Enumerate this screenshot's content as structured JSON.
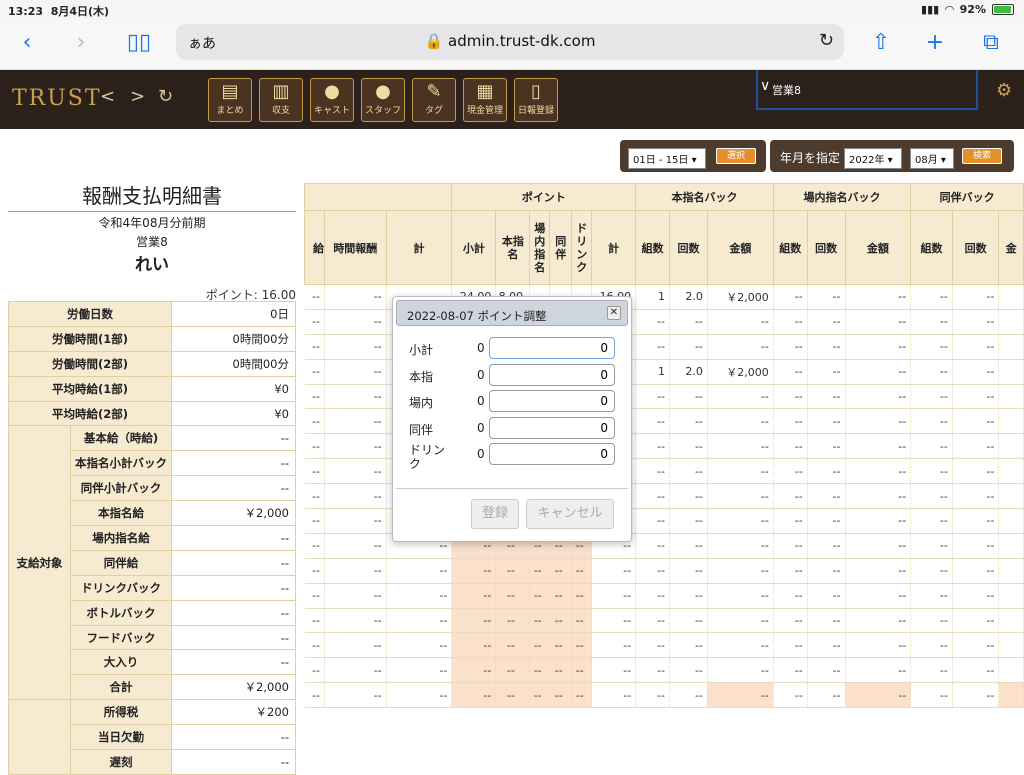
{
  "status": {
    "time": "13:23",
    "date": "8月4日(木)",
    "battery": "92%"
  },
  "browser": {
    "aa": "ぁあ",
    "url": "admin.trust-dk.com"
  },
  "app": {
    "logo": "TRUST",
    "tools": [
      "まとめ",
      "収支",
      "キャスト",
      "スタッフ",
      "タグ",
      "現金管理",
      "日報登録"
    ],
    "staff": "営業8"
  },
  "filters": {
    "range": "01日 - 15日",
    "select_btn": "選択",
    "month_label": "年月を指定",
    "year": "2022年",
    "month": "08月",
    "search_btn": "検索"
  },
  "left": {
    "title": "報酬支払明細書",
    "period": "令和4年08月分前期",
    "dept": "営業8",
    "name": "れい",
    "points": "ポイント: 16.00",
    "rows": [
      {
        "label": "労働日数",
        "value": "0日"
      },
      {
        "label": "労働時間(1部)",
        "value": "0時間00分"
      },
      {
        "label": "労働時間(2部)",
        "value": "0時間00分"
      },
      {
        "label": "平均時給(1部)",
        "value": "¥0"
      },
      {
        "label": "平均時給(2部)",
        "value": "¥0"
      }
    ],
    "pay_group": "支給対象",
    "pay_rows": [
      {
        "label": "基本給（時給)",
        "value": "--"
      },
      {
        "label": "本指名小計バック",
        "value": "--"
      },
      {
        "label": "同伴小計バック",
        "value": "--"
      },
      {
        "label": "本指名給",
        "value": "￥2,000"
      },
      {
        "label": "場内指名給",
        "value": "--"
      },
      {
        "label": "同伴給",
        "value": "--"
      },
      {
        "label": "ドリンクバック",
        "value": "--"
      },
      {
        "label": "ボトルバック",
        "value": "--"
      },
      {
        "label": "フードバック",
        "value": "--"
      },
      {
        "label": "大入り",
        "value": "--"
      },
      {
        "label": "合計",
        "value": "￥2,000"
      }
    ],
    "ded_rows": [
      {
        "label": "所得税",
        "value": "￥200"
      },
      {
        "label": "当日欠勤",
        "value": "--"
      },
      {
        "label": "遅刻",
        "value": "--"
      }
    ]
  },
  "table": {
    "groups": [
      "ポイント",
      "本指名バック",
      "場内指名バック",
      "同伴バック"
    ],
    "cols": [
      "給",
      "時間報酬",
      "計",
      "小計",
      "本指名",
      "場内指名",
      "同伴",
      "ドリンク",
      "計",
      "組数",
      "回数",
      "金額",
      "組数",
      "回数",
      "金額",
      "組数",
      "回数",
      "金"
    ],
    "rows": [
      [
        "--",
        "--",
        "",
        "24.00",
        "8.00",
        "",
        "",
        "",
        "16.00",
        "1",
        "2.0",
        "￥2,000",
        "--",
        "--",
        "--",
        "--",
        "--",
        ""
      ],
      [
        "--",
        "--",
        "",
        "",
        "",
        "",
        "",
        "",
        "",
        "--",
        "--",
        "--",
        "--",
        "--",
        "--",
        "--",
        "--",
        ""
      ],
      [
        "--",
        "--",
        "",
        "",
        "",
        "",
        "",
        "",
        "",
        "--",
        "--",
        "--",
        "--",
        "--",
        "--",
        "--",
        "--",
        ""
      ],
      [
        "--",
        "--",
        "",
        "",
        "",
        "",
        "",
        "",
        "",
        "1",
        "2.0",
        "￥2,000",
        "--",
        "--",
        "--",
        "--",
        "--",
        ""
      ],
      [
        "--",
        "--",
        "",
        "",
        "",
        "",
        "",
        "",
        "",
        "--",
        "--",
        "--",
        "--",
        "--",
        "--",
        "--",
        "--",
        ""
      ],
      [
        "--",
        "--",
        "",
        "",
        "",
        "",
        "",
        "",
        "",
        "--",
        "--",
        "--",
        "--",
        "--",
        "--",
        "--",
        "--",
        ""
      ],
      [
        "--",
        "--",
        "",
        "",
        "",
        "",
        "",
        "",
        "",
        "--",
        "--",
        "--",
        "--",
        "--",
        "--",
        "--",
        "--",
        ""
      ],
      [
        "--",
        "--",
        "",
        "",
        "",
        "",
        "",
        "",
        "",
        "--",
        "--",
        "--",
        "--",
        "--",
        "--",
        "--",
        "--",
        ""
      ],
      [
        "--",
        "--",
        "",
        "",
        "",
        "",
        "",
        "",
        "",
        "--",
        "--",
        "--",
        "--",
        "--",
        "--",
        "--",
        "--",
        ""
      ],
      [
        "--",
        "--",
        "",
        "",
        "",
        "",
        "",
        "",
        "",
        "--",
        "--",
        "--",
        "--",
        "--",
        "--",
        "--",
        "--",
        ""
      ],
      [
        "--",
        "--",
        "--",
        "--",
        "--",
        "--",
        "--",
        "--",
        "--",
        "--",
        "--",
        "--",
        "--",
        "--",
        "--",
        "--",
        "--",
        ""
      ],
      [
        "--",
        "--",
        "--",
        "--",
        "--",
        "--",
        "--",
        "--",
        "--",
        "--",
        "--",
        "--",
        "--",
        "--",
        "--",
        "--",
        "--",
        ""
      ],
      [
        "--",
        "--",
        "--",
        "--",
        "--",
        "--",
        "--",
        "--",
        "--",
        "--",
        "--",
        "--",
        "--",
        "--",
        "--",
        "--",
        "--",
        ""
      ],
      [
        "--",
        "--",
        "--",
        "--",
        "--",
        "--",
        "--",
        "--",
        "--",
        "--",
        "--",
        "--",
        "--",
        "--",
        "--",
        "--",
        "--",
        ""
      ],
      [
        "--",
        "--",
        "--",
        "--",
        "--",
        "--",
        "--",
        "--",
        "--",
        "--",
        "--",
        "--",
        "--",
        "--",
        "--",
        "--",
        "--",
        ""
      ],
      [
        "--",
        "--",
        "--",
        "--",
        "--",
        "--",
        "--",
        "--",
        "--",
        "--",
        "--",
        "--",
        "--",
        "--",
        "--",
        "--",
        "--",
        ""
      ],
      [
        "--",
        "--",
        "--",
        "--",
        "--",
        "--",
        "--",
        "--",
        "--",
        "--",
        "--",
        "--",
        "--",
        "--",
        "--",
        "--",
        "--",
        ""
      ]
    ]
  },
  "dialog": {
    "title": "2022-08-07 ポイント調整",
    "fields": [
      {
        "label": "小計",
        "current": "0",
        "value": "0"
      },
      {
        "label": "本指",
        "current": "0",
        "value": "0"
      },
      {
        "label": "場内",
        "current": "0",
        "value": "0"
      },
      {
        "label": "同伴",
        "current": "0",
        "value": "0"
      },
      {
        "label": "ドリンク",
        "current": "0",
        "value": "0"
      }
    ],
    "register": "登録",
    "cancel": "キャンセル"
  }
}
